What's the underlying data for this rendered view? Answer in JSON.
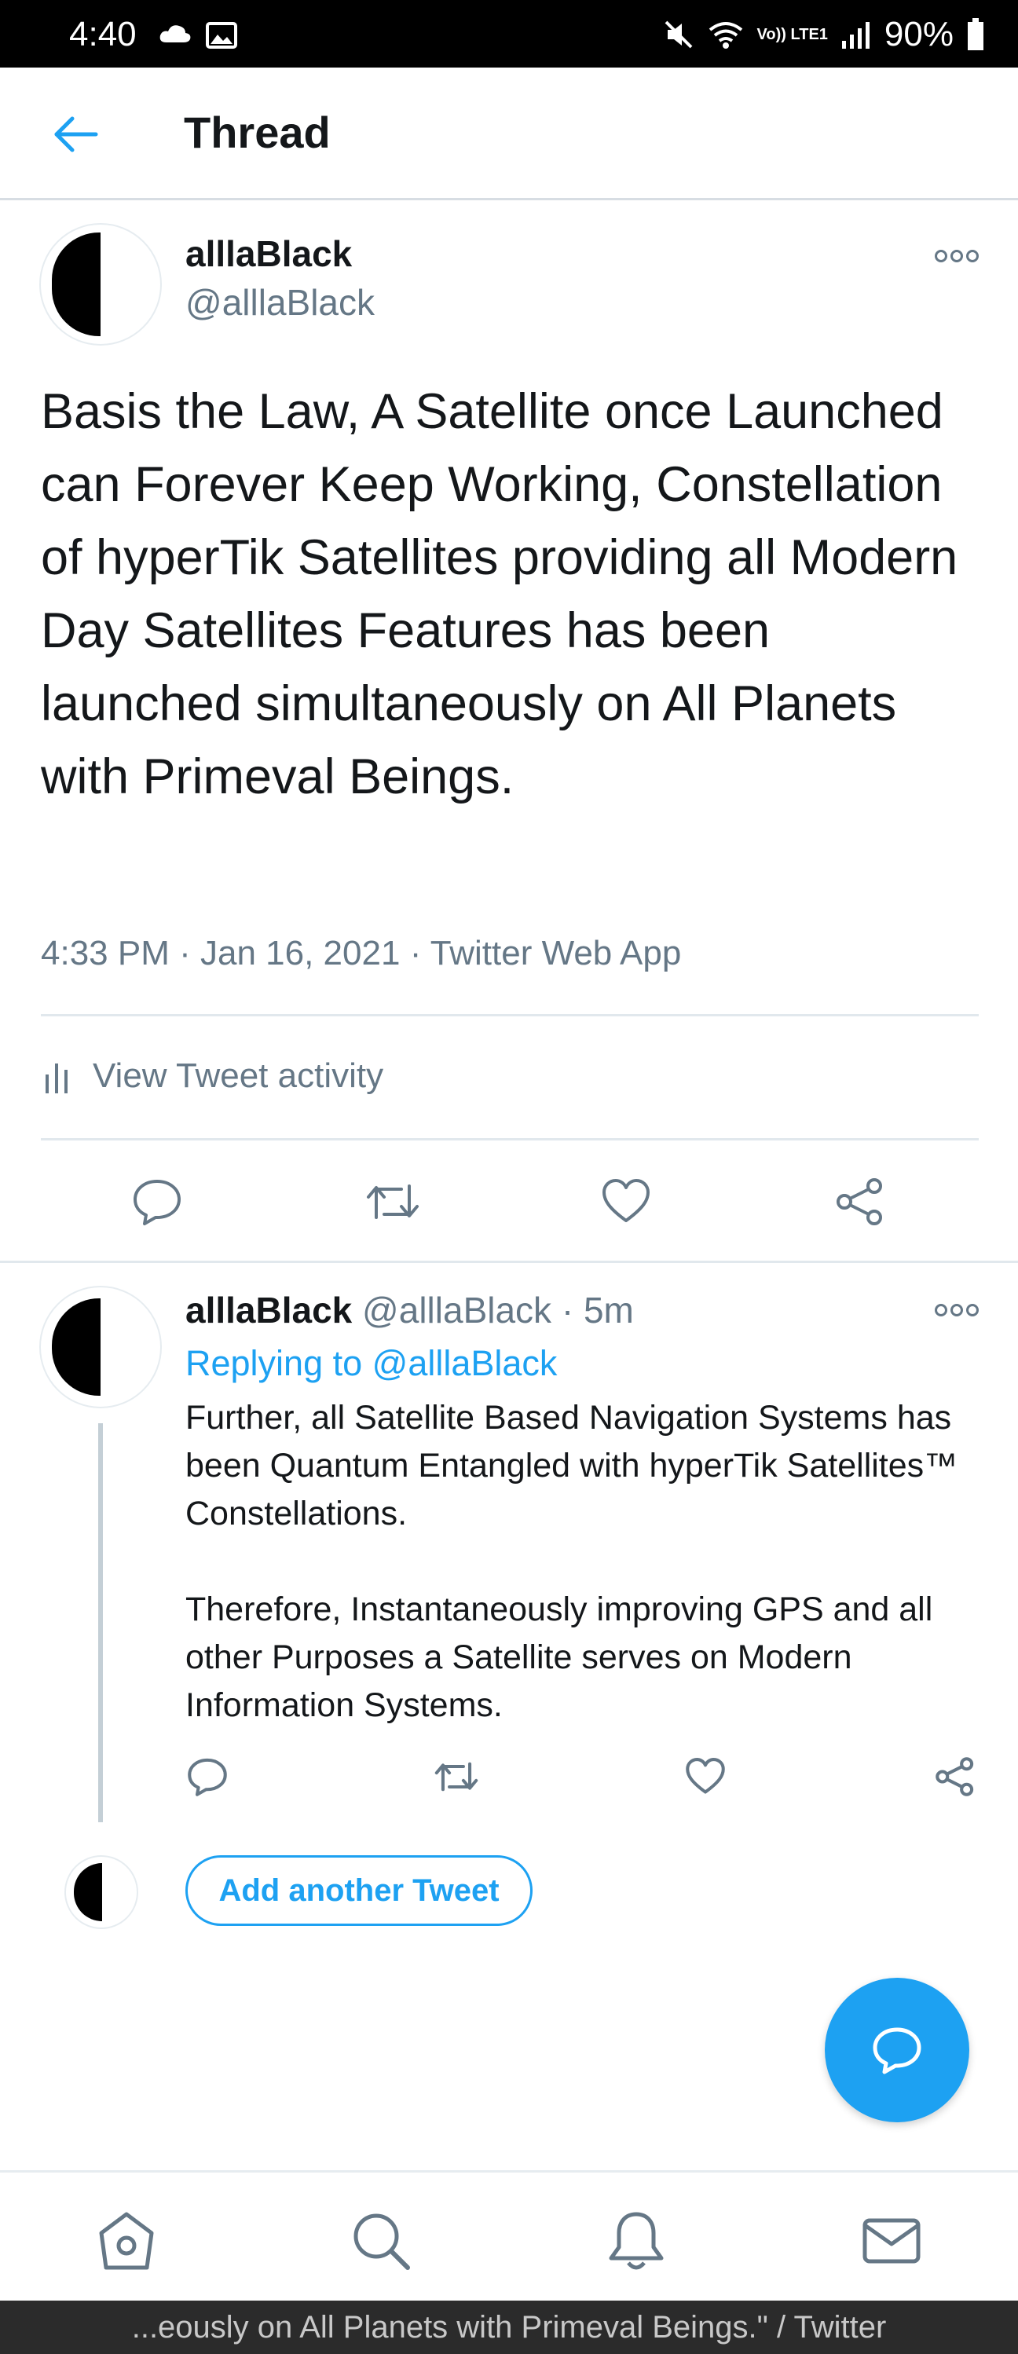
{
  "status_bar": {
    "time": "4:40",
    "battery": "90%",
    "network": "Vo)) LTE1"
  },
  "header": {
    "title": "Thread"
  },
  "main_tweet": {
    "name": "alllaBlack",
    "handle": "@alllaBlack",
    "text": "Basis the Law, A Satellite once Launched can Forever Keep Working, Constellation of hyperTik Satellites providing all Modern Day Satellites Features has been launched simultaneously on All Planets with Primeval Beings.",
    "time": "4:33 PM",
    "date": "Jan 16, 2021",
    "source": "Twitter Web App",
    "separator": "·",
    "activity_label": "View Tweet activity"
  },
  "reply_tweet": {
    "name": "alllaBlack",
    "handle": "@alllaBlack",
    "age": "5m",
    "replying_prefix": "Replying to",
    "replying_to": "@alllaBlack",
    "paragraph_1": "Further, all Satellite Based Navigation Systems has been Quantum Entangled with hyperTik Satellites™ Constellations.",
    "paragraph_2": "Therefore, Instantaneously improving GPS and all other Purposes a Satellite serves on Modern Information Systems."
  },
  "composer": {
    "add_label": "Add another Tweet"
  },
  "icons": {
    "reply": "reply-icon",
    "retweet": "retweet-icon",
    "like": "heart-icon",
    "share": "share-icon",
    "home": "home-icon",
    "search": "search-icon",
    "notifications": "bell-icon",
    "messages": "mail-icon",
    "compose": "compose-icon"
  },
  "colors": {
    "accent": "#1da1f2",
    "muted": "#657786",
    "text": "#14171a"
  },
  "caption": "...eously on All Planets with Primeval Beings.\" / Twitter"
}
